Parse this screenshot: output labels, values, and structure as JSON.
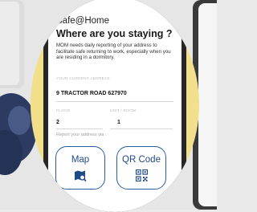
{
  "app": {
    "brand": "Safe@Home",
    "title": "Where are you staying ?",
    "description": "MOM needs daily reporting of your address to facilitate safe returning to work, especially when you are residing in a dormitory."
  },
  "form": {
    "address_label": "YOUR CURRENT ADDRESS",
    "address_value": "9 TRACTOR ROAD 627970",
    "floor_label": "FLOOR",
    "floor_value": "2",
    "unit_label": "UNIT / ROOM",
    "unit_value": "1"
  },
  "report": {
    "prompt": "Report your address via :",
    "map_label": "Map",
    "qr_label": "QR Code"
  },
  "colors": {
    "accent": "#1f4a8a",
    "background_circle": "#f2df8b"
  },
  "icons": {
    "map": "map-search-icon",
    "qr": "qr-code-icon"
  }
}
